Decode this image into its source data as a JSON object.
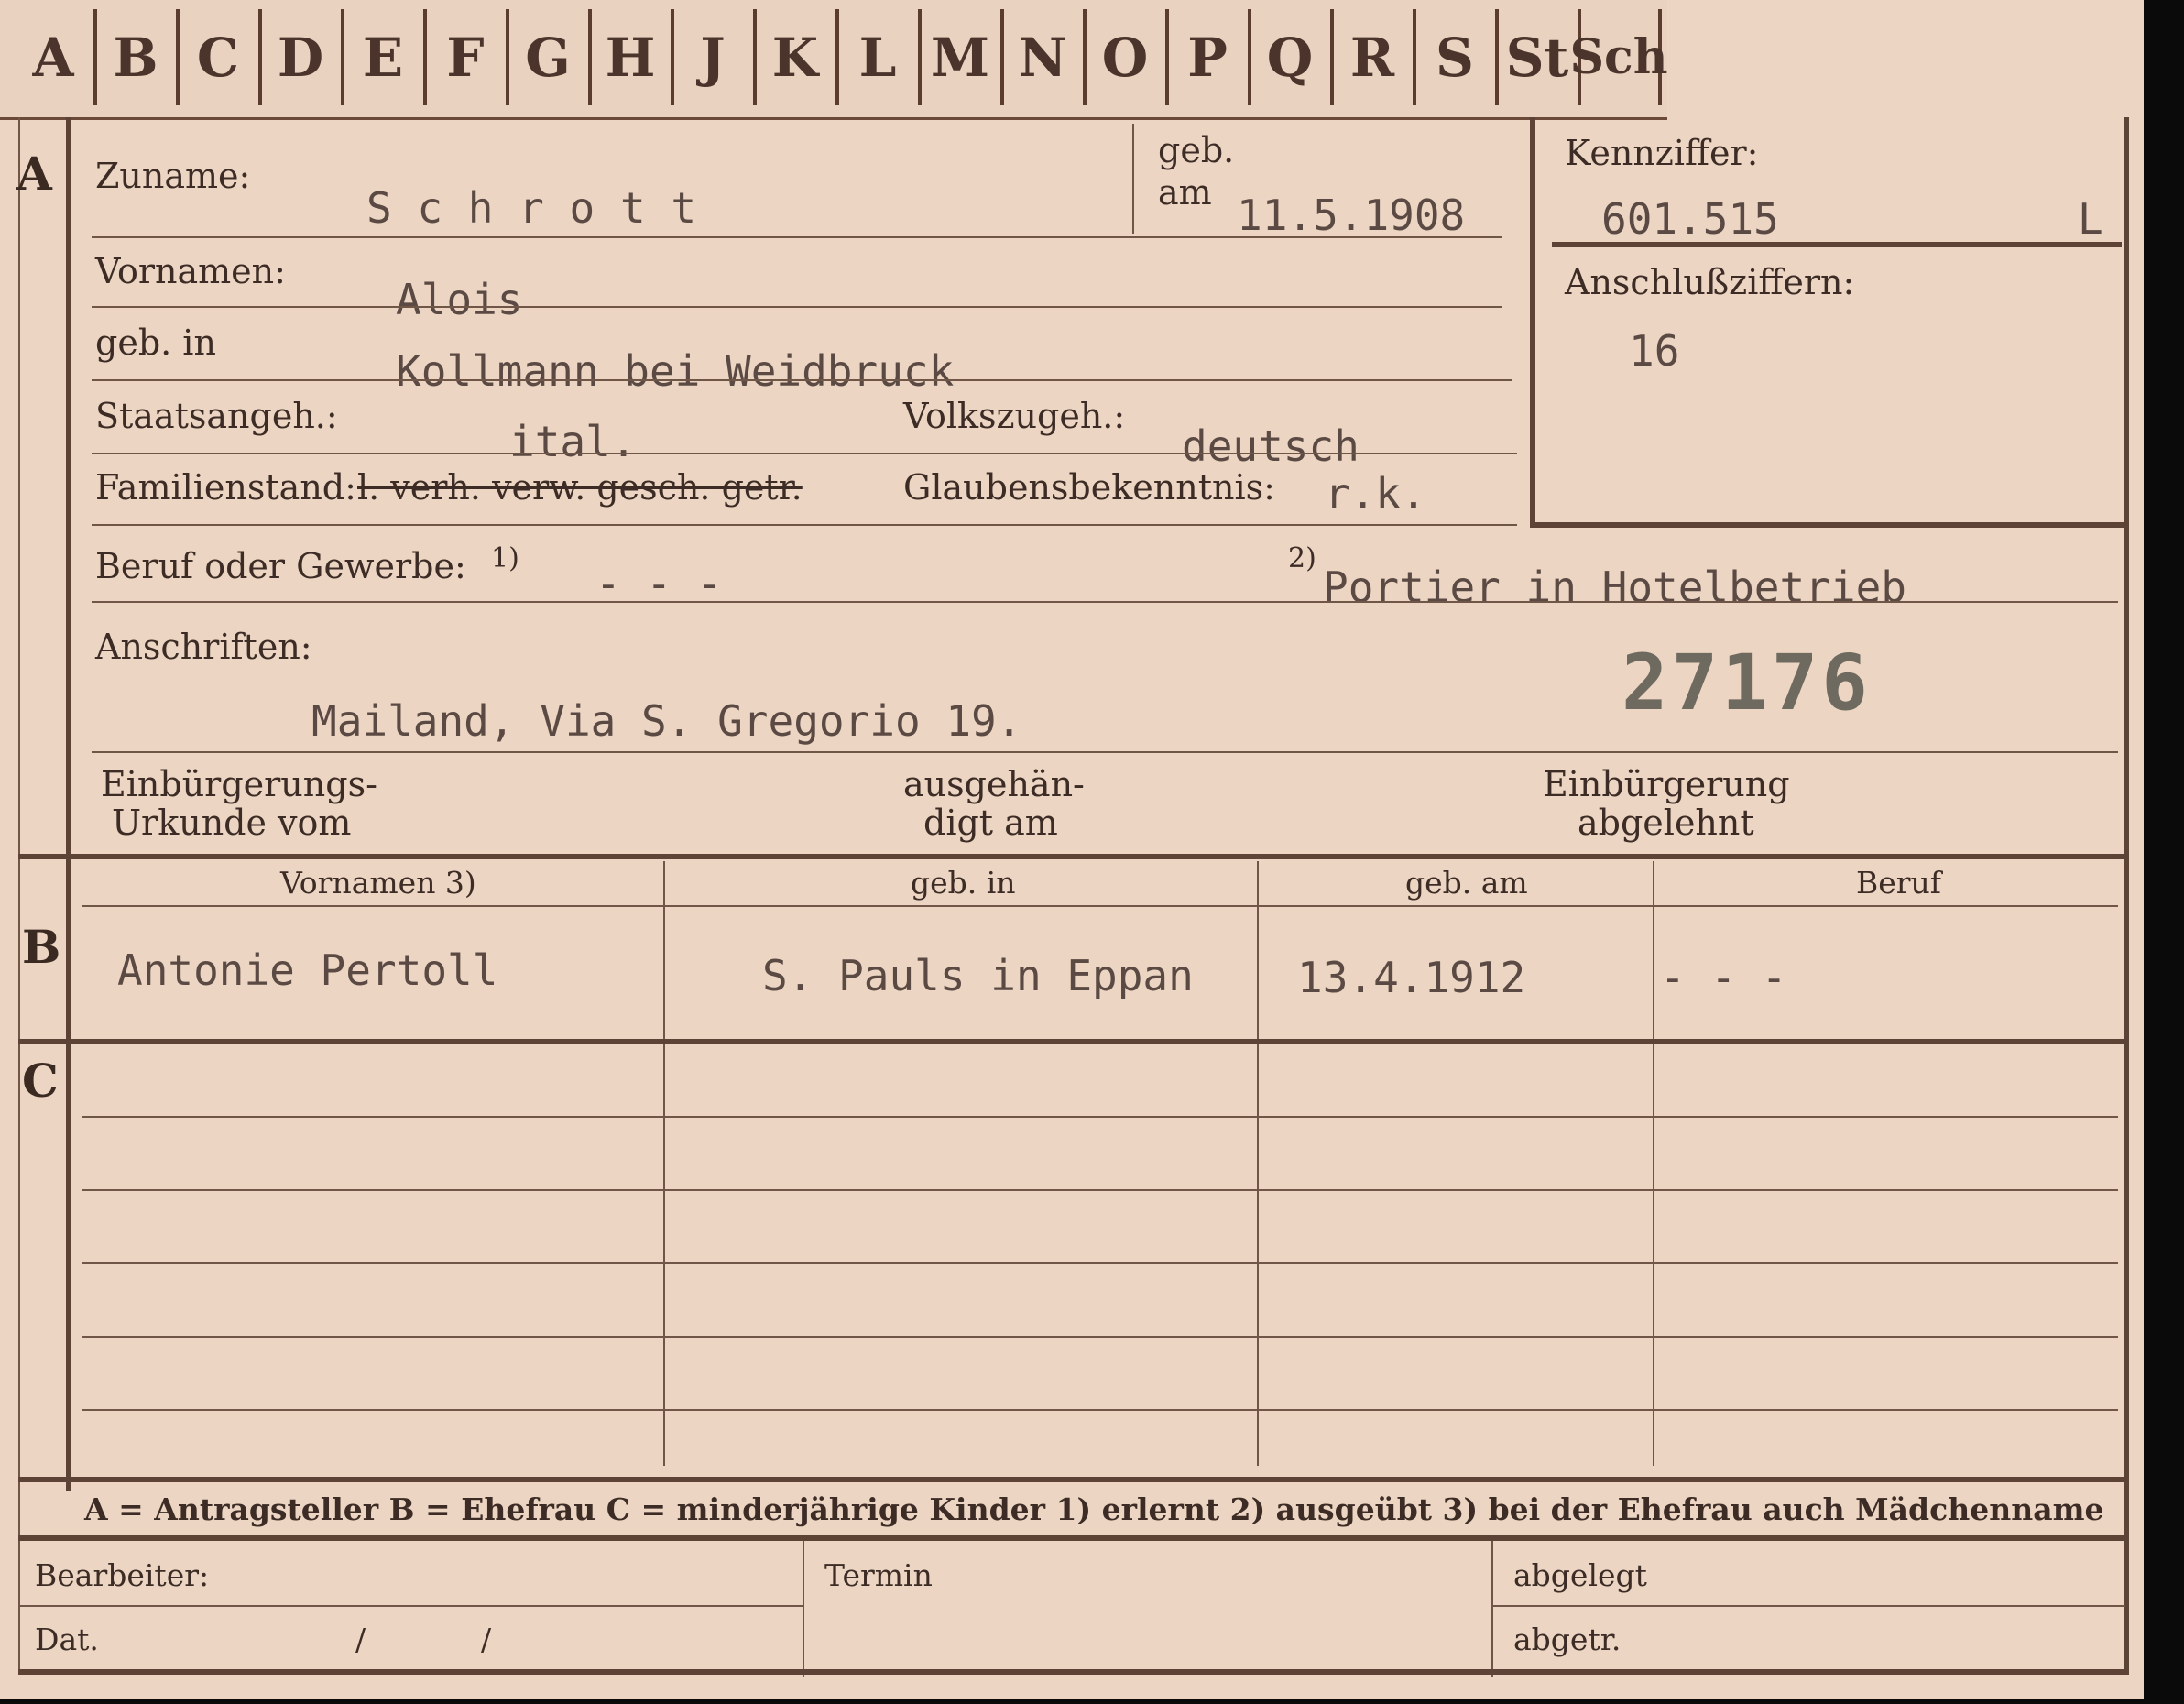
{
  "alphabet_tabs": [
    "A",
    "B",
    "C",
    "D",
    "E",
    "F",
    "G",
    "H",
    "J",
    "K",
    "L",
    "M",
    "N",
    "O",
    "P",
    "Q",
    "R",
    "S",
    "St",
    "Sch"
  ],
  "section_a": {
    "marker": "A",
    "zuname_label": "Zuname:",
    "zuname_value": "S c h r o t t",
    "geb_label_1": "geb.",
    "geb_label_2": "am",
    "geb_am_value": "11.5.1908",
    "vornamen_label": "Vornamen:",
    "vornamen_value": "Alois",
    "geb_in_label": "geb. in",
    "geb_in_value": "Kollmann bei Weidbruck",
    "staatsangeh_label": "Staatsangeh.:",
    "staatsangeh_value": "ital.",
    "volkszugeh_label": "Volkszugeh.:",
    "volkszugeh_value": "deutsch",
    "familienstand_label": "Familienstand:",
    "familienstand_options": "l.    verh.   verw.  gesch.  getr.",
    "glaubens_label": "Glaubensbekenntnis:",
    "glaubens_value": "r.k.",
    "beruf_label": "Beruf oder Gewerbe:",
    "beruf_note1": "1)",
    "beruf_value1": "- - -",
    "beruf_note2": "2)",
    "beruf_value2": "Portier in Hotelbetrieb",
    "anschriften_label": "Anschriften:",
    "anschriften_value": "Mailand, Via S. Gregorio 19.",
    "stamp_number": "27176",
    "einb_urkunde_label_1": "Einbürgerungs-",
    "einb_urkunde_label_2": "Urkunde vom",
    "ausgehaendigt_label_1": "ausgehän-",
    "ausgehaendigt_label_2": "digt am",
    "einb_abgelehnt_label_1": "Einbürgerung",
    "einb_abgelehnt_label_2": "abgelehnt"
  },
  "kennziffer": {
    "label": "Kennziffer:",
    "value": "601.515",
    "suffix": "L",
    "anschluss_label": "Anschlußziffern:",
    "anschluss_value": "16"
  },
  "section_b": {
    "marker": "B",
    "headers": [
      "Vornamen 3)",
      "geb. in",
      "geb. am",
      "Beruf"
    ],
    "row": [
      "Antonie Pertoll",
      "S. Pauls in Eppan",
      "13.4.1912",
      "- - -"
    ]
  },
  "section_c": {
    "marker": "C"
  },
  "legend": "A = Antragsteller   B = Ehefrau   C = minderjährige Kinder   1) erlernt   2) ausgeübt   3) bei der Ehefrau auch Mädchenname",
  "footer": {
    "bearbeiter_label": "Bearbeiter:",
    "termin_label": "Termin",
    "abgelegt_label": "abgelegt",
    "dat_label": "Dat.",
    "dat_slashes": "/            /",
    "abgetr_label": "abgetr."
  }
}
